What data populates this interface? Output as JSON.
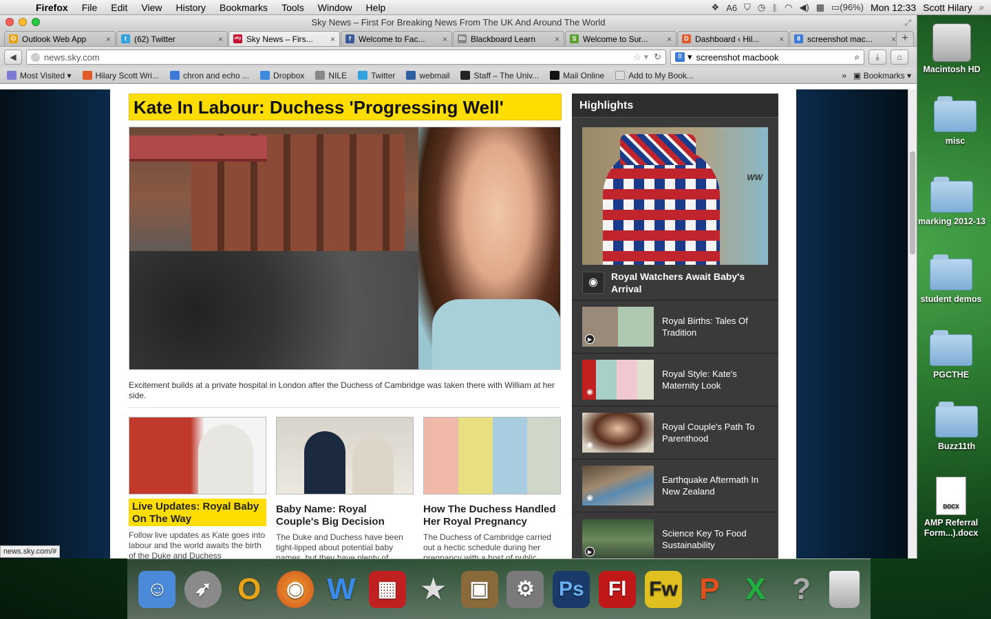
{
  "menubar": {
    "app": "Firefox",
    "items": [
      "File",
      "Edit",
      "View",
      "History",
      "Bookmarks",
      "Tools",
      "Window",
      "Help"
    ],
    "status_badge": "6",
    "battery": "(96%)",
    "clock": "Mon 12:33",
    "user": "Scott Hilary"
  },
  "window": {
    "title": "Sky News – First For Breaking News From The UK And Around The World"
  },
  "tabs": [
    {
      "label": "Outlook Web App",
      "color": "#e8a317",
      "glyph": "O"
    },
    {
      "label": "(62) Twitter",
      "color": "#33a0e0",
      "glyph": "t"
    },
    {
      "label": "Sky News – Firs...",
      "color": "#c8102e",
      "glyph": "sky"
    },
    {
      "label": "Welcome to Fac...",
      "color": "#3b5998",
      "glyph": "f"
    },
    {
      "label": "Blackboard Learn",
      "color": "#888888",
      "glyph": "Bb"
    },
    {
      "label": "Welcome to Sur...",
      "color": "#5aa02c",
      "glyph": "S"
    },
    {
      "label": "Dashboard ‹ Hil...",
      "color": "#e05a2a",
      "glyph": "D"
    },
    {
      "label": "screenshot mac...",
      "color": "#3b7ad8",
      "glyph": "8"
    }
  ],
  "navbar": {
    "url": "news.sky.com",
    "search_value": "screenshot macbook"
  },
  "bookmarks": [
    {
      "label": "Most Visited",
      "color": "#7a7ad0"
    },
    {
      "label": "Hilary Scott Wri...",
      "color": "#e05a2a"
    },
    {
      "label": "chron and echo ...",
      "color": "#3b7ad8"
    },
    {
      "label": "Dropbox",
      "color": "#3d8ae0"
    },
    {
      "label": "NILE",
      "color": "#888888"
    },
    {
      "label": "Twitter",
      "color": "#33a0e0"
    },
    {
      "label": "webmail",
      "color": "#3060a0"
    },
    {
      "label": "Staff – The Univ...",
      "color": "#222222"
    },
    {
      "label": "Mail Online",
      "color": "#111111"
    },
    {
      "label": "Add to My Book...",
      "color": "#cccccc"
    }
  ],
  "bookmarks_menu": "Bookmarks",
  "article": {
    "headline": "Kate In Labour: Duchess 'Progressing Well'",
    "caption": "Excitement builds at a private hospital in London after the Duchess of Cambridge was taken there with William at her side.",
    "cards": [
      {
        "title": "Live Updates: Royal Baby On The Way",
        "body": "Follow live updates as Kate goes into labour and the world awaits the birth of the Duke and Duchess"
      },
      {
        "title": "Baby Name: Royal Couple's Big Decision",
        "body": "The Duke and Duchess have been tight-lipped about potential baby names, but they have plenty of"
      },
      {
        "title": "How The Duchess Handled Her Royal Pregnancy",
        "body": "The Duchess of Cambridge carried out a hectic schedule during her pregnancy with a host of public"
      }
    ]
  },
  "highlights": {
    "heading": "Highlights",
    "feature_title": "Royal Watchers Await Baby's Arrival",
    "feature_sign": "WW",
    "items": [
      {
        "title": "Royal Births: Tales Of Tradition",
        "kind": "video"
      },
      {
        "title": "Royal Style: Kate's Maternity Look",
        "kind": "photo"
      },
      {
        "title": "Royal Couple's Path To Parenthood",
        "kind": "photo"
      },
      {
        "title": "Earthquake Aftermath In New Zealand",
        "kind": "photo"
      },
      {
        "title": "Science Key To Food Sustainability",
        "kind": "video"
      }
    ]
  },
  "statusbar": "news.sky.com/#",
  "desktop": [
    {
      "label": "Macintosh HD",
      "type": "drive"
    },
    {
      "label": "misc",
      "type": "folder"
    },
    {
      "label": "marking 2012-13",
      "type": "folder"
    },
    {
      "label": "student demos",
      "type": "folder"
    },
    {
      "label": "PGCTHE",
      "type": "folder"
    },
    {
      "label": "Buzz11th",
      "type": "folder"
    },
    {
      "label": "AMP Referral Form...).docx",
      "type": "doc",
      "badge": "DOCX"
    }
  ],
  "dock": [
    {
      "name": "finder",
      "glyph": "☺",
      "color": "#4a8ad8"
    },
    {
      "name": "launchpad",
      "glyph": "🚀",
      "color": "#8a8a8a"
    },
    {
      "name": "outlook",
      "glyph": "O",
      "color": "#e8a317"
    },
    {
      "name": "firefox",
      "glyph": "🦊",
      "color": "#e8601c"
    },
    {
      "name": "word",
      "glyph": "W",
      "color": "#2a7ae0"
    },
    {
      "name": "photo-booth",
      "glyph": "▦",
      "color": "#c02020"
    },
    {
      "name": "imovie",
      "glyph": "★",
      "color": "#6a6a6a"
    },
    {
      "name": "iphoto",
      "glyph": "▣",
      "color": "#8a6a3a"
    },
    {
      "name": "system-preferences",
      "glyph": "⚙",
      "color": "#7a7a7a"
    },
    {
      "name": "photoshop",
      "glyph": "Ps",
      "color": "#1a4a8a"
    },
    {
      "name": "flash",
      "glyph": "Fl",
      "color": "#c01818"
    },
    {
      "name": "fireworks",
      "glyph": "Fw",
      "color": "#e0c020"
    },
    {
      "name": "powerpoint",
      "glyph": "P",
      "color": "#e0501c"
    },
    {
      "name": "excel",
      "glyph": "X",
      "color": "#20a040"
    },
    {
      "name": "unknown-app",
      "glyph": "?",
      "color": "#999999"
    },
    {
      "name": "trash",
      "glyph": "🗑",
      "color": "#9a9a9a"
    }
  ]
}
